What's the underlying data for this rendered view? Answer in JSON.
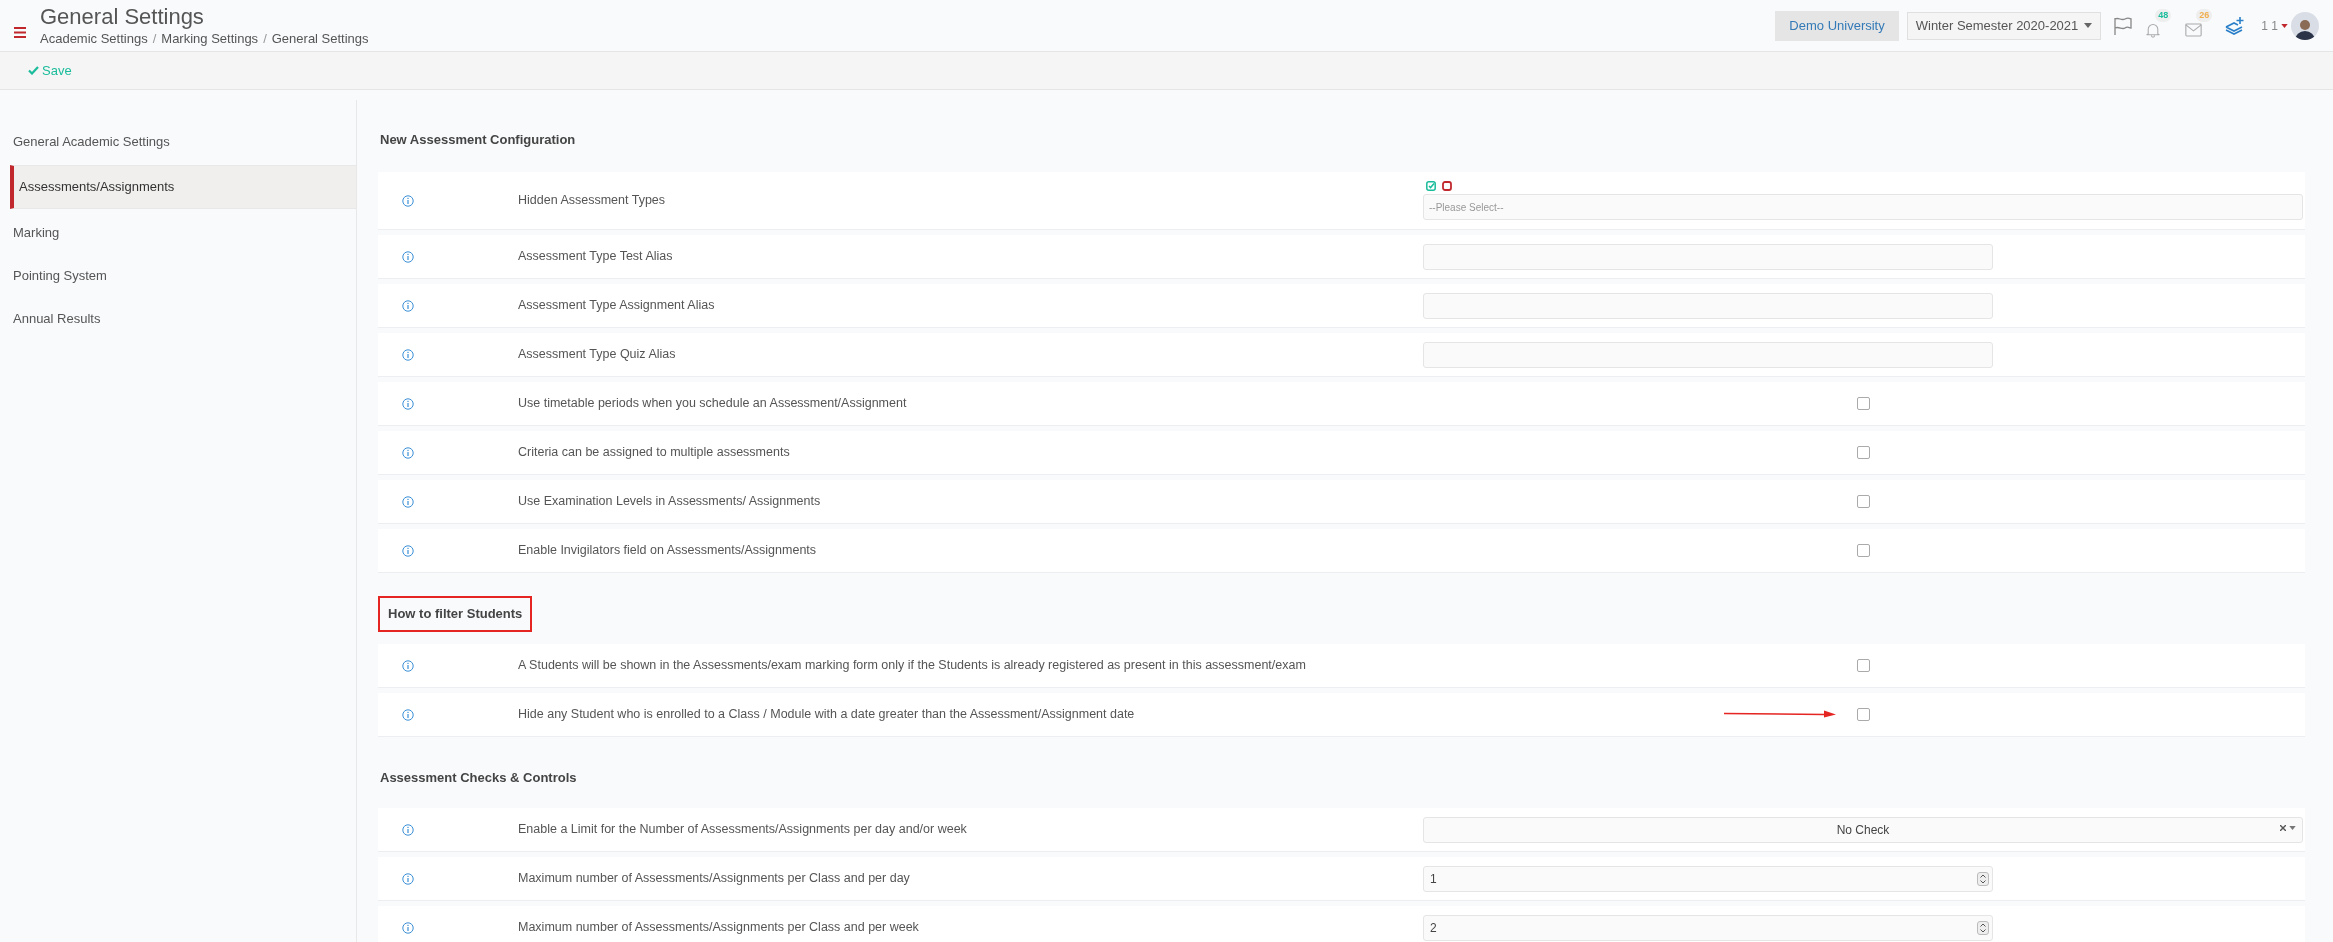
{
  "header": {
    "title": "General Settings",
    "breadcrumb": [
      "Academic Settings",
      "Marking Settings",
      "General Settings"
    ],
    "breadcrumb_separator": "/",
    "institution": "Demo University",
    "semester": "Winter Semester 2020-2021",
    "notifications_count": "48",
    "messages_count": "26",
    "user_label": "1 1"
  },
  "toolbar": {
    "save_label": "Save"
  },
  "sidebar": {
    "items": [
      {
        "label": "General Academic Settings",
        "selected": false
      },
      {
        "label": "Assessments/Assignments",
        "selected": true
      },
      {
        "label": "Marking",
        "selected": false
      },
      {
        "label": "Pointing System",
        "selected": false
      },
      {
        "label": "Annual Results",
        "selected": false
      }
    ]
  },
  "sections": [
    {
      "title": "New Assessment Configuration",
      "highlighted": false,
      "rows": [
        {
          "label": "Hidden Assessment Types",
          "kind": "multiselect",
          "placeholder": "--Please Select--"
        },
        {
          "label": "Assessment Type Test Alias",
          "kind": "text"
        },
        {
          "label": "Assessment Type Assignment Alias",
          "kind": "text"
        },
        {
          "label": "Assessment Type Quiz Alias",
          "kind": "text"
        },
        {
          "label": "Use timetable periods when you schedule an Assessment/Assignment",
          "kind": "checkbox",
          "checked": false
        },
        {
          "label": "Criteria can be assigned to multiple assessments",
          "kind": "checkbox",
          "checked": false
        },
        {
          "label": "Use Examination Levels in Assessments/ Assignments",
          "kind": "checkbox",
          "checked": false
        },
        {
          "label": "Enable Invigilators field on Assessments/Assignments",
          "kind": "checkbox",
          "checked": false
        }
      ]
    },
    {
      "title": "How to filter Students",
      "highlighted": true,
      "rows": [
        {
          "label": "A Students will be shown in the Assessments/exam marking form only if the Students is already registered as present in this assessment/exam",
          "kind": "checkbox",
          "checked": false
        },
        {
          "label": "Hide any Student who is enrolled to a Class / Module with a date greater than the Assessment/Assignment date",
          "kind": "checkbox",
          "checked": false,
          "annotated": true
        }
      ]
    },
    {
      "title": "Assessment Checks & Controls",
      "highlighted": false,
      "rows": [
        {
          "label": "Enable a Limit for the Number of Assessments/Assignments per day and/or week",
          "kind": "select",
          "value": "No Check"
        },
        {
          "label": "Maximum number of Assessments/Assignments per Class and per day",
          "kind": "number",
          "value": "1"
        },
        {
          "label": "Maximum number of Assessments/Assignments per Class and per week",
          "kind": "number",
          "value": "2"
        }
      ]
    }
  ]
}
